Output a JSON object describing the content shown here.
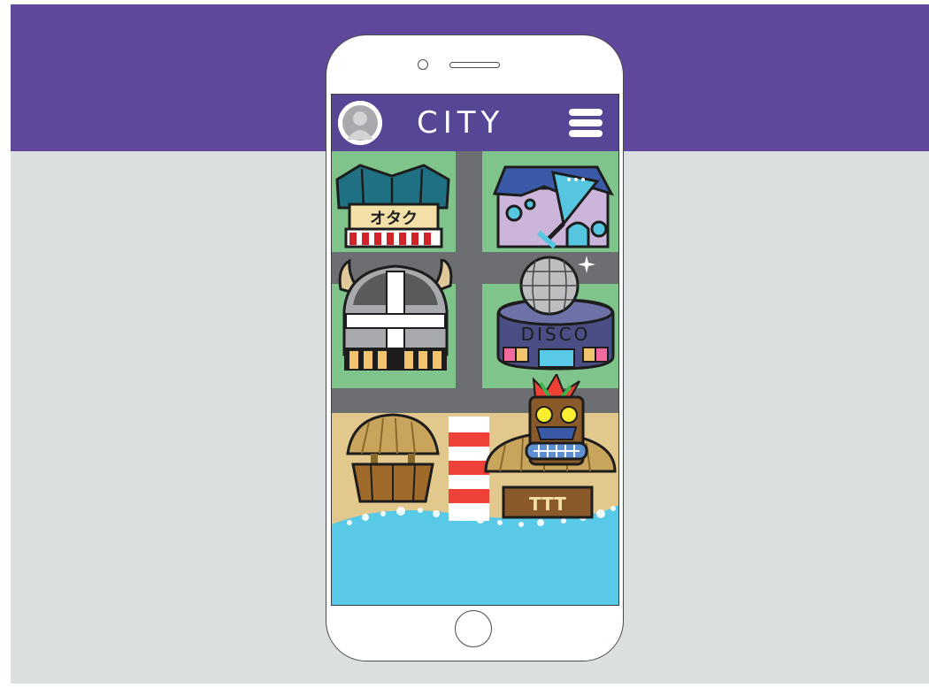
{
  "app": {
    "title": "CITY"
  },
  "header": {
    "avatar_icon": "user-avatar-icon",
    "menu_icon": "hamburger-menu-icon"
  },
  "map": {
    "buildings": [
      {
        "id": "otaku",
        "icon": "japanese-shop-icon",
        "sign": "オタク"
      },
      {
        "id": "cocktail",
        "icon": "cocktail-bar-icon"
      },
      {
        "id": "viking",
        "icon": "viking-helmet-icon"
      },
      {
        "id": "disco",
        "icon": "disco-ball-club-icon",
        "sign": "DISCO"
      },
      {
        "id": "hut",
        "icon": "beach-hut-icon"
      },
      {
        "id": "lighthouse",
        "icon": "striped-tower-icon"
      },
      {
        "id": "tiki",
        "icon": "tiki-bar-icon",
        "sign": "TTT"
      }
    ]
  },
  "colors": {
    "banner": "#5f479c",
    "background": "#dcdfe0",
    "appbar": "#574596",
    "grass": "#7fc48b",
    "road": "#6d6e71",
    "sand": "#e2c88d",
    "water": "#58c9e6"
  }
}
